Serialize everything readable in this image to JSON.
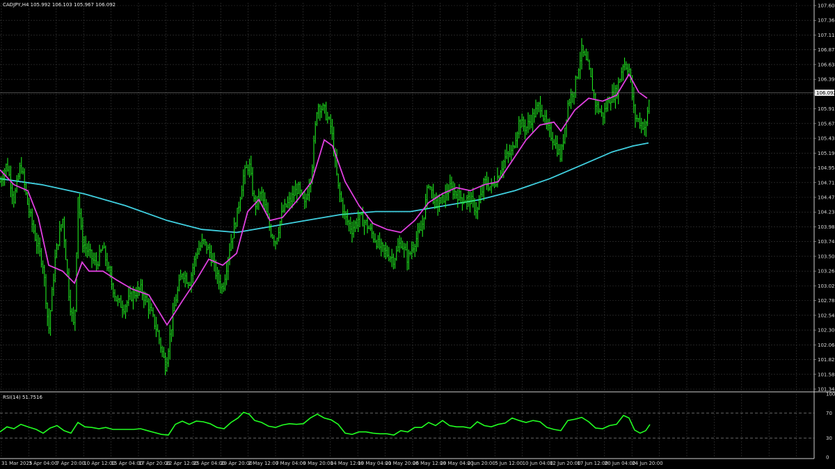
{
  "header": {
    "symbol_info": "CADJPY,H4  105.992 106.103 105.967 106.092",
    "rsi_info": "RSI(14) 51.7516"
  },
  "colors": {
    "background": "#000000",
    "grid": "#3a3a3a",
    "candle": "#22ff22",
    "ma_fast": "#e040e0",
    "ma_slow": "#40d0e0",
    "rsi_line": "#22ff22",
    "axis_text": "#d8d8d8"
  },
  "chart_data": [
    {
      "type": "candlestick",
      "symbol": "CADJPY",
      "timeframe": "H4",
      "ylim": [
        101.1,
        107.6
      ],
      "price_ticks": [
        "107.600",
        "107.360",
        "107.115",
        "106.875",
        "106.635",
        "106.395",
        "106.155",
        "105.915",
        "105.670",
        "105.430",
        "105.190",
        "104.950",
        "104.710",
        "104.470",
        "104.230",
        "103.985",
        "103.745",
        "103.505",
        "103.265",
        "103.025",
        "102.785",
        "102.545",
        "102.300",
        "102.060",
        "101.820",
        "101.580",
        "101.340"
      ],
      "x_labels": [
        "31 Mar 2025",
        "3 Apr 04:00",
        "7 Apr 20:00",
        "10 Apr 12:00",
        "15 Apr 04:00",
        "17 Apr 20:00",
        "22 Apr 12:00",
        "25 Apr 04:00",
        "29 Apr 20:00",
        "2 May 12:00",
        "7 May 04:00",
        "9 May 20:00",
        "14 May 12:00",
        "19 May 04:00",
        "21 May 20:00",
        "26 May 12:00",
        "29 May 04:00",
        "2 Jun 20:00",
        "5 Jun 12:00",
        "10 Jun 04:00",
        "12 Jun 20:00",
        "17 Jun 12:00",
        "20 Jun 04:00",
        "24 Jun 20:00"
      ],
      "current_price": "106.092",
      "price_path": [
        [
          0,
          104.6
        ],
        [
          10,
          104.9
        ],
        [
          20,
          104.3
        ],
        [
          30,
          104.9
        ],
        [
          40,
          104.2
        ],
        [
          52,
          103.6
        ],
        [
          62,
          103.2
        ],
        [
          70,
          102.1
        ],
        [
          80,
          103.4
        ],
        [
          90,
          104.0
        ],
        [
          100,
          102.6
        ],
        [
          107,
          102.1
        ],
        [
          112,
          104.4
        ],
        [
          118,
          103.6
        ],
        [
          128,
          103.4
        ],
        [
          138,
          103.2
        ],
        [
          148,
          103.5
        ],
        [
          158,
          103.0
        ],
        [
          168,
          102.6
        ],
        [
          178,
          102.5
        ],
        [
          190,
          102.7
        ],
        [
          202,
          102.8
        ],
        [
          214,
          102.5
        ],
        [
          226,
          102.1
        ],
        [
          238,
          101.5
        ],
        [
          244,
          102.0
        ],
        [
          252,
          102.6
        ],
        [
          262,
          103.1
        ],
        [
          272,
          102.9
        ],
        [
          282,
          103.4
        ],
        [
          292,
          103.6
        ],
        [
          302,
          103.4
        ],
        [
          312,
          103.0
        ],
        [
          320,
          102.8
        ],
        [
          330,
          103.5
        ],
        [
          340,
          104.0
        ],
        [
          350,
          104.7
        ],
        [
          358,
          104.9
        ],
        [
          366,
          104.2
        ],
        [
          376,
          104.4
        ],
        [
          388,
          103.8
        ],
        [
          396,
          103.6
        ],
        [
          406,
          104.1
        ],
        [
          418,
          104.3
        ],
        [
          428,
          104.5
        ],
        [
          438,
          104.2
        ],
        [
          448,
          104.8
        ],
        [
          456,
          105.9
        ],
        [
          466,
          105.8
        ],
        [
          476,
          105.5
        ],
        [
          486,
          104.5
        ],
        [
          496,
          104.0
        ],
        [
          506,
          103.8
        ],
        [
          516,
          104.0
        ],
        [
          526,
          103.9
        ],
        [
          536,
          103.7
        ],
        [
          546,
          103.5
        ],
        [
          556,
          103.4
        ],
        [
          566,
          103.3
        ],
        [
          576,
          103.6
        ],
        [
          586,
          103.3
        ],
        [
          596,
          103.6
        ],
        [
          606,
          103.8
        ],
        [
          616,
          104.6
        ],
        [
          626,
          104.2
        ],
        [
          636,
          104.3
        ],
        [
          646,
          104.5
        ],
        [
          656,
          104.4
        ],
        [
          666,
          104.3
        ],
        [
          676,
          104.3
        ],
        [
          686,
          104.1
        ],
        [
          696,
          104.6
        ],
        [
          706,
          104.5
        ],
        [
          716,
          104.7
        ],
        [
          726,
          105.0
        ],
        [
          736,
          105.1
        ],
        [
          746,
          105.6
        ],
        [
          756,
          105.5
        ],
        [
          766,
          105.7
        ],
        [
          776,
          105.9
        ],
        [
          786,
          105.5
        ],
        [
          796,
          105.3
        ],
        [
          806,
          105.0
        ],
        [
          816,
          105.9
        ],
        [
          826,
          106.2
        ],
        [
          836,
          106.8
        ],
        [
          846,
          106.5
        ],
        [
          856,
          105.9
        ],
        [
          866,
          105.7
        ],
        [
          876,
          106.0
        ],
        [
          886,
          106.1
        ],
        [
          896,
          106.6
        ],
        [
          904,
          106.5
        ],
        [
          912,
          105.7
        ],
        [
          920,
          105.6
        ],
        [
          928,
          105.5
        ],
        [
          934,
          106.09
        ]
      ],
      "ma_fast_path": [
        [
          0,
          104.8
        ],
        [
          20,
          104.55
        ],
        [
          40,
          104.45
        ],
        [
          55,
          104.0
        ],
        [
          70,
          103.2
        ],
        [
          90,
          103.1
        ],
        [
          107,
          102.9
        ],
        [
          118,
          103.25
        ],
        [
          128,
          103.1
        ],
        [
          148,
          103.1
        ],
        [
          168,
          102.95
        ],
        [
          190,
          102.8
        ],
        [
          214,
          102.7
        ],
        [
          240,
          102.2
        ],
        [
          262,
          102.6
        ],
        [
          282,
          102.95
        ],
        [
          300,
          103.3
        ],
        [
          320,
          103.2
        ],
        [
          340,
          103.4
        ],
        [
          356,
          104.1
        ],
        [
          372,
          104.3
        ],
        [
          388,
          103.95
        ],
        [
          406,
          104.0
        ],
        [
          428,
          104.3
        ],
        [
          448,
          104.6
        ],
        [
          466,
          105.3
        ],
        [
          478,
          105.2
        ],
        [
          496,
          104.6
        ],
        [
          516,
          104.2
        ],
        [
          536,
          103.9
        ],
        [
          556,
          103.8
        ],
        [
          576,
          103.75
        ],
        [
          596,
          103.95
        ],
        [
          616,
          104.25
        ],
        [
          636,
          104.4
        ],
        [
          656,
          104.5
        ],
        [
          676,
          104.45
        ],
        [
          696,
          104.55
        ],
        [
          716,
          104.6
        ],
        [
          736,
          104.95
        ],
        [
          756,
          105.3
        ],
        [
          776,
          105.55
        ],
        [
          796,
          105.6
        ],
        [
          806,
          105.45
        ],
        [
          826,
          105.8
        ],
        [
          846,
          106.0
        ],
        [
          866,
          105.95
        ],
        [
          886,
          106.05
        ],
        [
          904,
          106.4
        ],
        [
          918,
          106.1
        ],
        [
          930,
          106.0
        ]
      ],
      "ma_slow_path": [
        [
          0,
          104.65
        ],
        [
          60,
          104.55
        ],
        [
          120,
          104.4
        ],
        [
          180,
          104.2
        ],
        [
          240,
          103.95
        ],
        [
          290,
          103.8
        ],
        [
          340,
          103.75
        ],
        [
          390,
          103.85
        ],
        [
          440,
          103.95
        ],
        [
          490,
          104.05
        ],
        [
          540,
          104.1
        ],
        [
          590,
          104.1
        ],
        [
          640,
          104.2
        ],
        [
          690,
          104.3
        ],
        [
          740,
          104.45
        ],
        [
          790,
          104.65
        ],
        [
          840,
          104.9
        ],
        [
          880,
          105.1
        ],
        [
          910,
          105.2
        ],
        [
          932,
          105.25
        ]
      ]
    },
    {
      "type": "line",
      "name": "RSI(14)",
      "ylim": [
        0,
        100
      ],
      "y_ticks": [
        "100",
        "70",
        "30",
        "0"
      ],
      "levels": [
        70,
        30
      ],
      "current": 51.7516,
      "rsi_path": [
        [
          0,
          40
        ],
        [
          10,
          48
        ],
        [
          20,
          45
        ],
        [
          30,
          52
        ],
        [
          40,
          48
        ],
        [
          52,
          44
        ],
        [
          62,
          38
        ],
        [
          72,
          46
        ],
        [
          82,
          50
        ],
        [
          92,
          42
        ],
        [
          102,
          38
        ],
        [
          112,
          55
        ],
        [
          122,
          48
        ],
        [
          132,
          47
        ],
        [
          142,
          45
        ],
        [
          152,
          47
        ],
        [
          162,
          44
        ],
        [
          172,
          44
        ],
        [
          182,
          44
        ],
        [
          192,
          44
        ],
        [
          202,
          45
        ],
        [
          212,
          42
        ],
        [
          222,
          39
        ],
        [
          232,
          36
        ],
        [
          242,
          35
        ],
        [
          252,
          52
        ],
        [
          262,
          57
        ],
        [
          272,
          52
        ],
        [
          282,
          57
        ],
        [
          292,
          56
        ],
        [
          302,
          53
        ],
        [
          312,
          47
        ],
        [
          322,
          45
        ],
        [
          332,
          55
        ],
        [
          342,
          62
        ],
        [
          350,
          71
        ],
        [
          358,
          68
        ],
        [
          366,
          58
        ],
        [
          376,
          55
        ],
        [
          386,
          49
        ],
        [
          396,
          47
        ],
        [
          406,
          51
        ],
        [
          416,
          53
        ],
        [
          426,
          52
        ],
        [
          436,
          53
        ],
        [
          446,
          62
        ],
        [
          456,
          68
        ],
        [
          466,
          62
        ],
        [
          476,
          59
        ],
        [
          486,
          52
        ],
        [
          496,
          38
        ],
        [
          506,
          36
        ],
        [
          516,
          40
        ],
        [
          526,
          40
        ],
        [
          536,
          38
        ],
        [
          546,
          37
        ],
        [
          556,
          37
        ],
        [
          566,
          35
        ],
        [
          576,
          42
        ],
        [
          586,
          40
        ],
        [
          596,
          47
        ],
        [
          606,
          47
        ],
        [
          616,
          55
        ],
        [
          626,
          50
        ],
        [
          636,
          58
        ],
        [
          646,
          50
        ],
        [
          656,
          48
        ],
        [
          666,
          48
        ],
        [
          676,
          46
        ],
        [
          686,
          56
        ],
        [
          696,
          50
        ],
        [
          706,
          48
        ],
        [
          716,
          52
        ],
        [
          726,
          54
        ],
        [
          736,
          62
        ],
        [
          746,
          58
        ],
        [
          756,
          55
        ],
        [
          766,
          58
        ],
        [
          776,
          56
        ],
        [
          786,
          47
        ],
        [
          796,
          44
        ],
        [
          806,
          42
        ],
        [
          816,
          58
        ],
        [
          826,
          60
        ],
        [
          836,
          63
        ],
        [
          846,
          56
        ],
        [
          856,
          46
        ],
        [
          866,
          45
        ],
        [
          876,
          50
        ],
        [
          886,
          52
        ],
        [
          896,
          66
        ],
        [
          904,
          62
        ],
        [
          912,
          43
        ],
        [
          920,
          38
        ],
        [
          928,
          42
        ],
        [
          934,
          51.75
        ]
      ]
    }
  ]
}
